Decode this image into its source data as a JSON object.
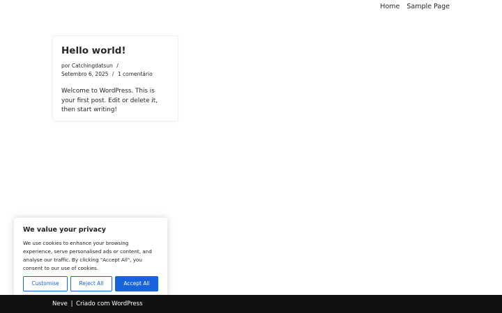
{
  "nav": {
    "items": [
      {
        "label": "Home"
      },
      {
        "label": "Sample Page"
      }
    ]
  },
  "post": {
    "title": "Hello world!",
    "meta": {
      "by_label": "por",
      "author": "Catchingdatsun",
      "separator": "/",
      "date": "Setembro 6, 2025",
      "comments": "1 comentário"
    },
    "excerpt": "Welcome to WordPress. This is your first post. Edit or delete it, then start writing!"
  },
  "cookie_banner": {
    "title": "We value your privacy",
    "text": "We use cookies to enhance your browsing experience, serve personalised ads or content, and analyse our traffic. By clicking \"Accept All\", you consent to our use of cookies.",
    "buttons": {
      "customise": "Customise",
      "reject": "Reject All",
      "accept": "Accept All"
    },
    "accent_color": "#1863dc"
  },
  "footer": {
    "theme_link": "Neve",
    "divider": "|",
    "credit": "Criado com WordPress",
    "background_color": "#111111"
  }
}
